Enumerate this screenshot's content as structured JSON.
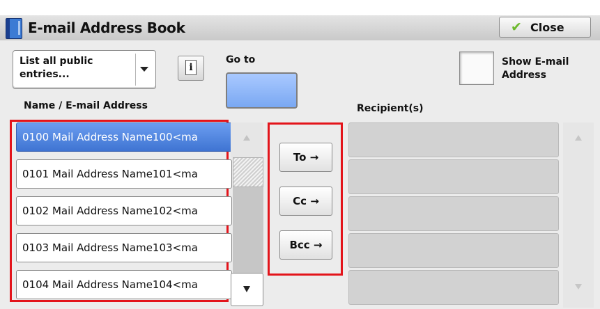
{
  "window": {
    "title": "E-mail Address Book",
    "close_label": "Close"
  },
  "controls": {
    "filter_value": "List all public entries...",
    "goto_label": "Go to",
    "goto_value": "",
    "show_email_label": "Show E-mail Address",
    "show_email_checked": false
  },
  "headers": {
    "name_email": "Name / E-mail Address",
    "recipients": "Recipient(s)"
  },
  "entries": [
    {
      "text": "0100  Mail Address Name100<ma",
      "selected": true
    },
    {
      "text": "0101  Mail Address Name101<ma",
      "selected": false
    },
    {
      "text": "0102  Mail Address Name102<ma",
      "selected": false
    },
    {
      "text": "0103  Mail Address Name103<ma",
      "selected": false
    },
    {
      "text": "0104  Mail Address Name104<ma",
      "selected": false
    }
  ],
  "destination_buttons": {
    "to": "To →",
    "cc": "Cc →",
    "bcc": "Bcc →"
  },
  "recipients": [
    "",
    "",
    "",
    "",
    ""
  ],
  "colors": {
    "highlight_frame": "#e3141b",
    "selected_row": "#4a7fdc",
    "goto_field": "#8fb6f7"
  }
}
